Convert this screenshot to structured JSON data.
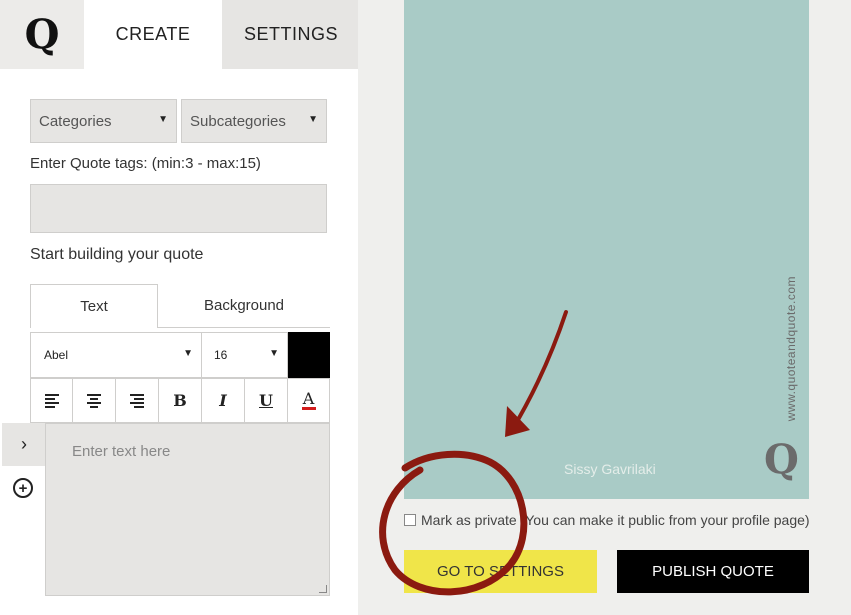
{
  "logo": {
    "letter": "Q"
  },
  "nav": {
    "create": "CREATE",
    "settings": "SETTINGS"
  },
  "filters": {
    "categories": "Categories",
    "subcategories": "Subcategories"
  },
  "tags": {
    "label": "Enter Quote tags: (min:3 - max:15)",
    "value": ""
  },
  "builder": {
    "label": "Start building your quote",
    "tabs": {
      "text": "Text",
      "background": "Background"
    },
    "font": "Abel",
    "size": "16",
    "text_color": "#000000",
    "format": {
      "bold": "B",
      "italic": "I",
      "underline": "U",
      "color": "A"
    },
    "side_toggle": "›",
    "add": "+",
    "text_placeholder": "Enter text here"
  },
  "preview": {
    "background": "#a9cbc6",
    "author": "Sissy Gavrilaki",
    "site": "www.quoteandquote.com",
    "watermark": "Q"
  },
  "private": {
    "label": "Mark as private (You can make it public from your profile page)",
    "checked": false
  },
  "buttons": {
    "go_to_settings": "GO TO SETTINGS",
    "publish": "PUBLISH QUOTE"
  },
  "colors": {
    "accent_yellow": "#f0e549",
    "annotation_red": "#8b1a10"
  }
}
